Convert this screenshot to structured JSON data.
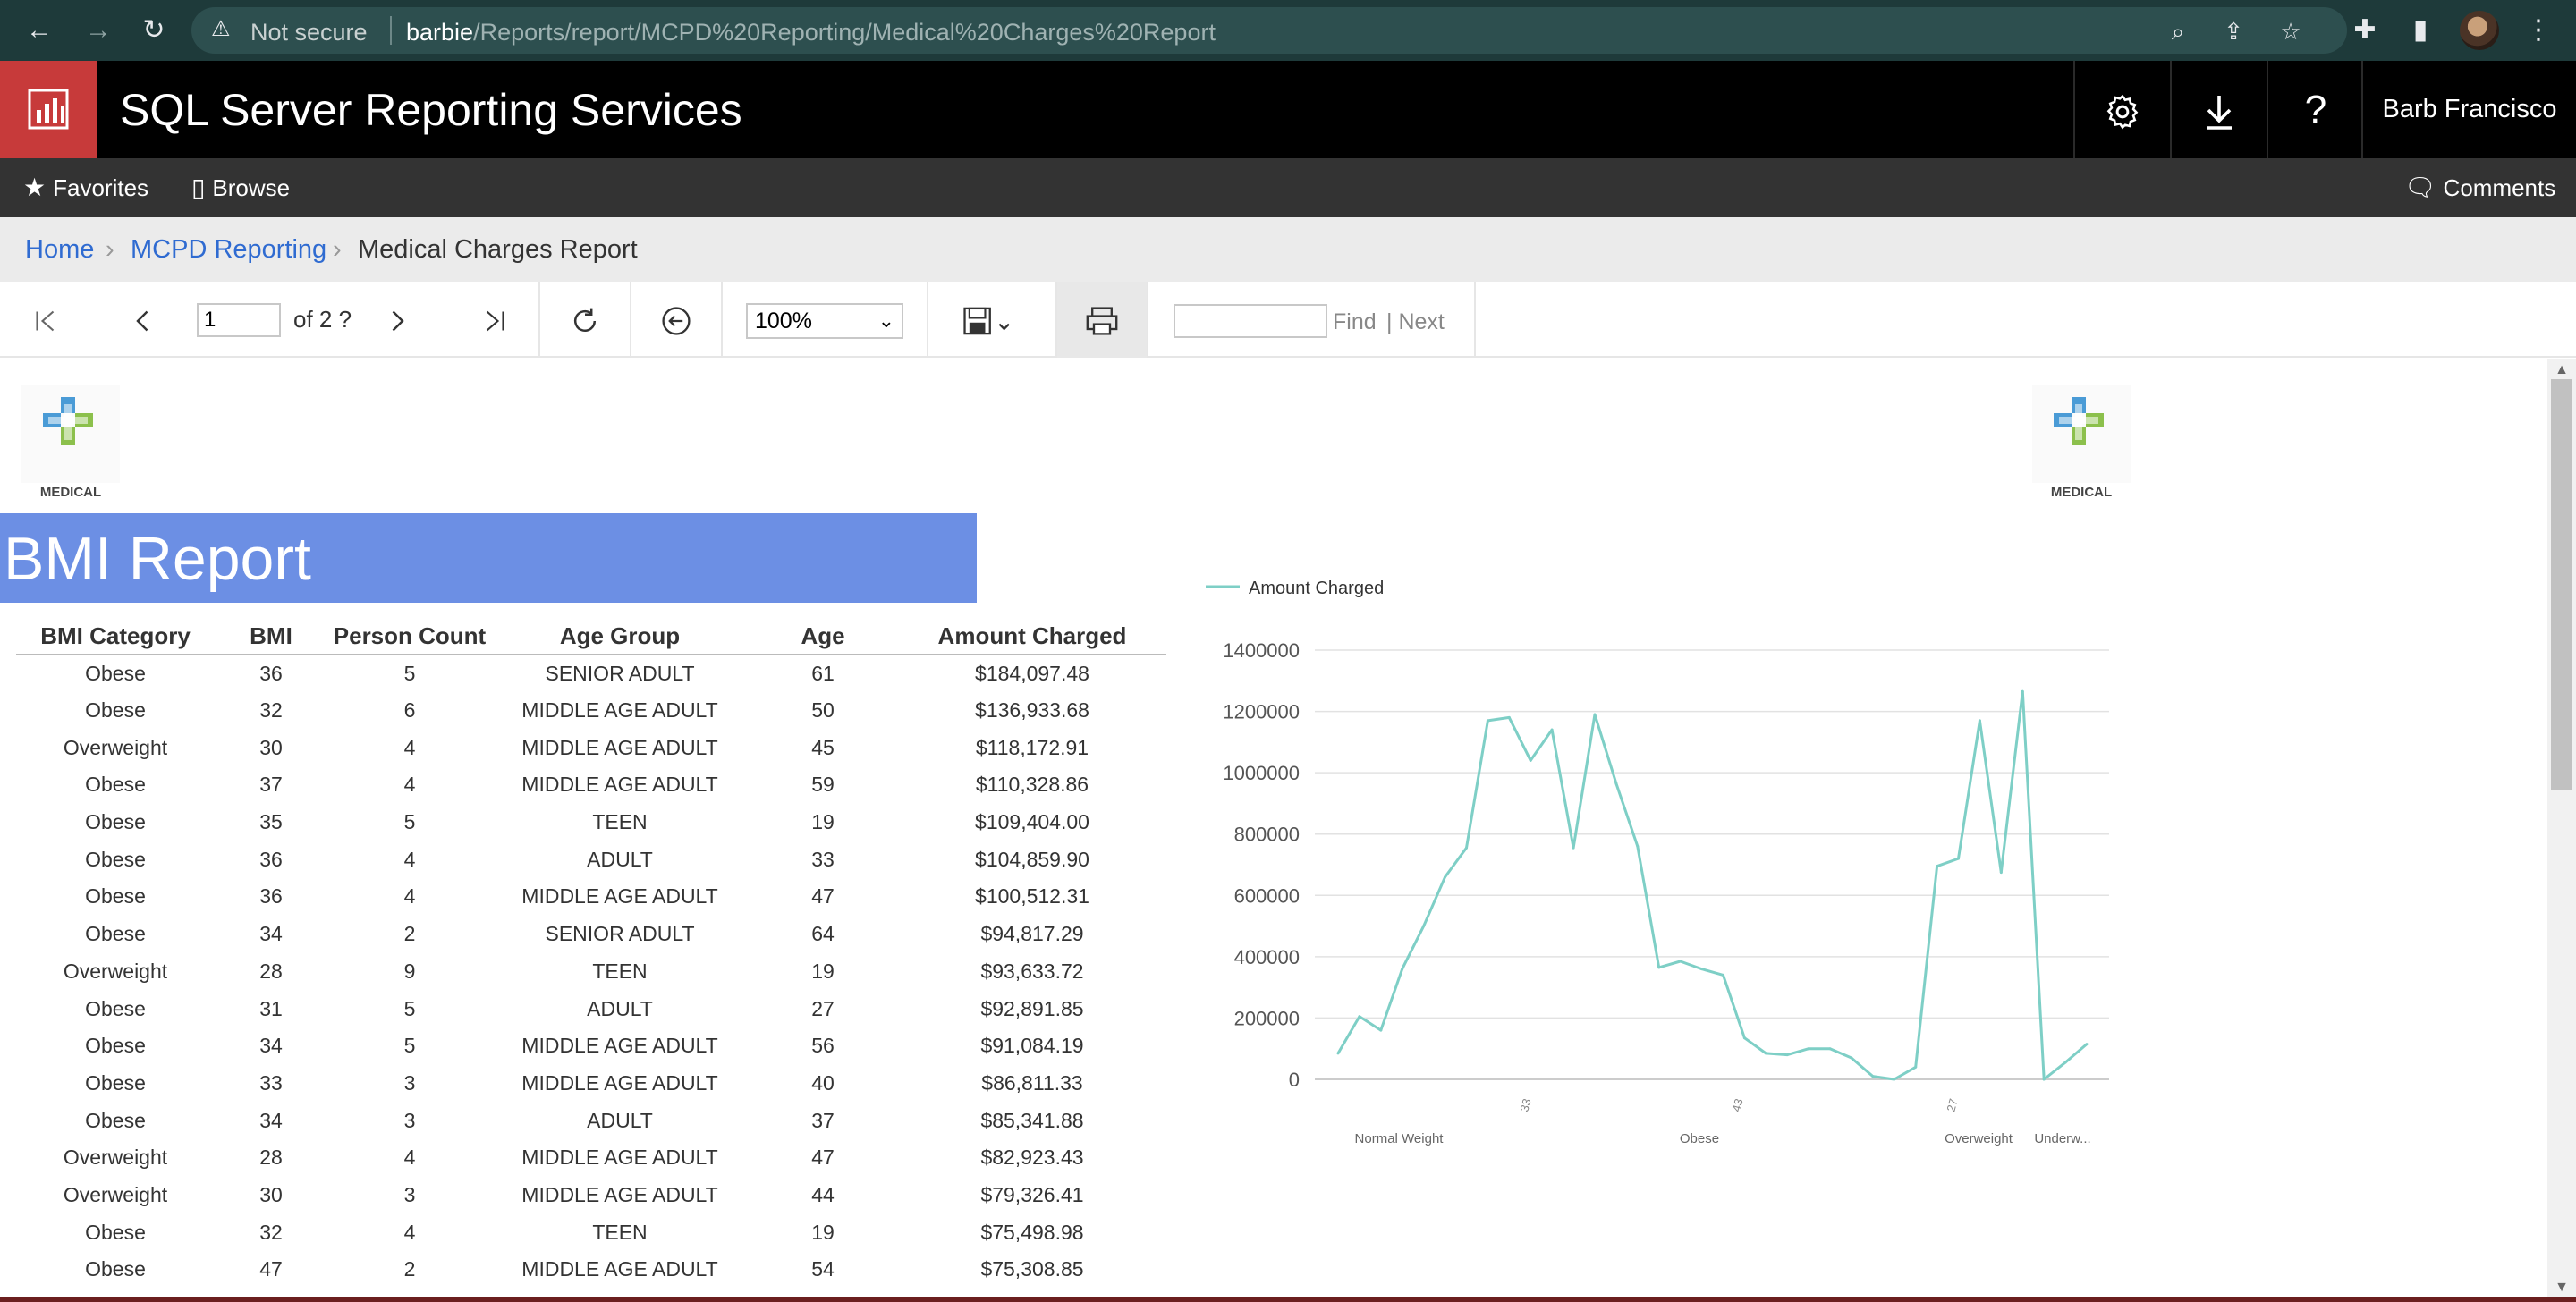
{
  "browser": {
    "security_label": "Not secure",
    "url_host": "barbie",
    "url_path": "/Reports/report/MCPD%20Reporting/Medical%20Charges%20Report"
  },
  "header": {
    "app_title": "SQL Server Reporting Services",
    "user_name": "Barb Francisco"
  },
  "navbar": {
    "favorites": "Favorites",
    "browse": "Browse",
    "comments": "Comments"
  },
  "breadcrumb": {
    "home": "Home",
    "folder": "MCPD Reporting",
    "current": "Medical Charges Report"
  },
  "toolbar": {
    "page_value": "1",
    "of_pages": "of 2 ?",
    "zoom": "100%",
    "find": "Find",
    "next": "| Next"
  },
  "report": {
    "logo_text": "MEDICAL",
    "title": "BMI Report",
    "columns": [
      "BMI Category",
      "BMI",
      "Person Count",
      "Age Group",
      "Age",
      "Amount Charged"
    ],
    "rows": [
      [
        "Obese",
        "36",
        "5",
        "SENIOR ADULT",
        "61",
        "$184,097.48"
      ],
      [
        "Obese",
        "32",
        "6",
        "MIDDLE AGE ADULT",
        "50",
        "$136,933.68"
      ],
      [
        "Overweight",
        "30",
        "4",
        "MIDDLE AGE ADULT",
        "45",
        "$118,172.91"
      ],
      [
        "Obese",
        "37",
        "4",
        "MIDDLE AGE ADULT",
        "59",
        "$110,328.86"
      ],
      [
        "Obese",
        "35",
        "5",
        "TEEN",
        "19",
        "$109,404.00"
      ],
      [
        "Obese",
        "36",
        "4",
        "ADULT",
        "33",
        "$104,859.90"
      ],
      [
        "Obese",
        "36",
        "4",
        "MIDDLE AGE ADULT",
        "47",
        "$100,512.31"
      ],
      [
        "Obese",
        "34",
        "2",
        "SENIOR ADULT",
        "64",
        "$94,817.29"
      ],
      [
        "Overweight",
        "28",
        "9",
        "TEEN",
        "19",
        "$93,633.72"
      ],
      [
        "Obese",
        "31",
        "5",
        "ADULT",
        "27",
        "$92,891.85"
      ],
      [
        "Obese",
        "34",
        "5",
        "MIDDLE AGE ADULT",
        "56",
        "$91,084.19"
      ],
      [
        "Obese",
        "33",
        "3",
        "MIDDLE AGE ADULT",
        "40",
        "$86,811.33"
      ],
      [
        "Obese",
        "34",
        "3",
        "ADULT",
        "37",
        "$85,341.88"
      ],
      [
        "Overweight",
        "28",
        "4",
        "MIDDLE AGE ADULT",
        "47",
        "$82,923.43"
      ],
      [
        "Overweight",
        "30",
        "3",
        "MIDDLE AGE ADULT",
        "44",
        "$79,326.41"
      ],
      [
        "Obese",
        "32",
        "4",
        "TEEN",
        "19",
        "$75,498.98"
      ],
      [
        "Obese",
        "47",
        "2",
        "MIDDLE AGE ADULT",
        "54",
        "$75,308.85"
      ]
    ]
  },
  "colors": {
    "brand_red": "#c73a3a",
    "banner_blue": "#6c8fe4",
    "link_blue": "#2f6bd1",
    "series": "#7ecfc6"
  },
  "chart_data": {
    "type": "line",
    "legend": [
      "Amount Charged"
    ],
    "legend_position": "top-left",
    "ylim": [
      0,
      1400000
    ],
    "yticks": [
      "1400000",
      "1200000",
      "1000000",
      "800000",
      "600000",
      "400000",
      "200000",
      "0"
    ],
    "category_labels": [
      "Normal Weight",
      "Obese",
      "Overweight",
      "Underw..."
    ],
    "rotated_tick_labels": [
      "33",
      "43",
      "27"
    ],
    "series": [
      {
        "name": "Amount Charged",
        "values": [
          85000,
          205000,
          160000,
          360000,
          500000,
          660000,
          755000,
          1170000,
          1180000,
          1040000,
          1140000,
          755000,
          1190000,
          965000,
          760000,
          365000,
          385000,
          360000,
          340000,
          135000,
          85000,
          80000,
          100000,
          100000,
          70000,
          10000,
          0,
          40000,
          695000,
          720000,
          1170000,
          675000,
          1265000,
          0,
          55000,
          115000
        ]
      }
    ]
  }
}
